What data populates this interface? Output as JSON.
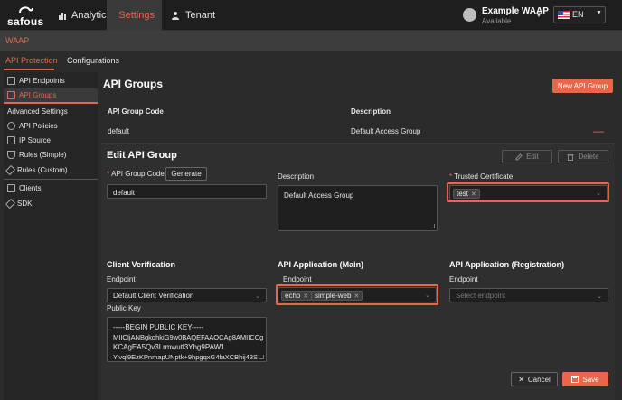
{
  "brand": {
    "logo_text": "safous"
  },
  "topnav": {
    "tabs": [
      {
        "label": "Analytics",
        "icon": "bar-chart-icon"
      },
      {
        "label": "Settings",
        "icon": "gear-icon"
      },
      {
        "label": "Tenant",
        "icon": "users-icon"
      }
    ],
    "user": {
      "name": "Example WAAP",
      "status": "Available"
    },
    "language": "EN"
  },
  "section": {
    "title": "WAAP"
  },
  "subtabs": [
    "API Protection",
    "Configurations"
  ],
  "sidebar": {
    "items_top": [
      {
        "label": "API Endpoints",
        "icon": "grid-icon"
      },
      {
        "label": "API Groups",
        "icon": "grid-icon"
      }
    ],
    "advanced_heading": "Advanced Settings",
    "items_advanced": [
      {
        "label": "API Policies",
        "icon": "gear-icon"
      },
      {
        "label": "IP Source",
        "icon": "network-icon"
      },
      {
        "label": "Rules (Simple)",
        "icon": "shield-icon"
      },
      {
        "label": "Rules (Custom)",
        "icon": "wrench-icon"
      }
    ],
    "items_bottom": [
      {
        "label": "Clients",
        "icon": "monitor-icon"
      },
      {
        "label": "SDK",
        "icon": "wrench-icon"
      }
    ]
  },
  "main": {
    "title": "API Groups",
    "new_button": "New API Group",
    "table": {
      "headers": [
        "API Group Code",
        "Description"
      ],
      "rows": [
        {
          "code": "default",
          "description": "Default Access Group"
        }
      ]
    }
  },
  "edit": {
    "title": "Edit API Group",
    "edit_button": "Edit",
    "delete_button": "Delete",
    "group_code_label": "API Group Code",
    "generate_button": "Generate",
    "group_code_value": "default",
    "description_label": "Description",
    "description_value": "Default Access Group",
    "trusted_cert_label": "Trusted Certificate",
    "trusted_cert_tags": [
      "test"
    ],
    "client_verification": {
      "heading": "Client Verification",
      "endpoint_label": "Endpoint",
      "endpoint_value": "Default Client Verification",
      "public_key_label": "Public Key",
      "public_key_lines": [
        "-----BEGIN PUBLIC KEY-----",
        "MIICIjANBgkqhkiG9w0BAQEFAAOCAg8AMIICCg",
        "KCAgEA5Qv3Lrmwutl3Yhg9PAW1",
        "Yivql9EzKPnmapUNptk+9hpgqxG4faXCBhij43S"
      ]
    },
    "api_app_main": {
      "heading": "API Application (Main)",
      "endpoint_label": "Endpoint",
      "tags": [
        "echo",
        "simple-web"
      ]
    },
    "api_app_registration": {
      "heading": "API Application (Registration)",
      "endpoint_label": "Endpoint",
      "placeholder": "Select endpoint"
    },
    "cancel_button": "Cancel",
    "save_button": "Save"
  },
  "colors": {
    "accent": "#e9664a",
    "background": "#2b2b2b",
    "nav": "#1e1e1e"
  }
}
